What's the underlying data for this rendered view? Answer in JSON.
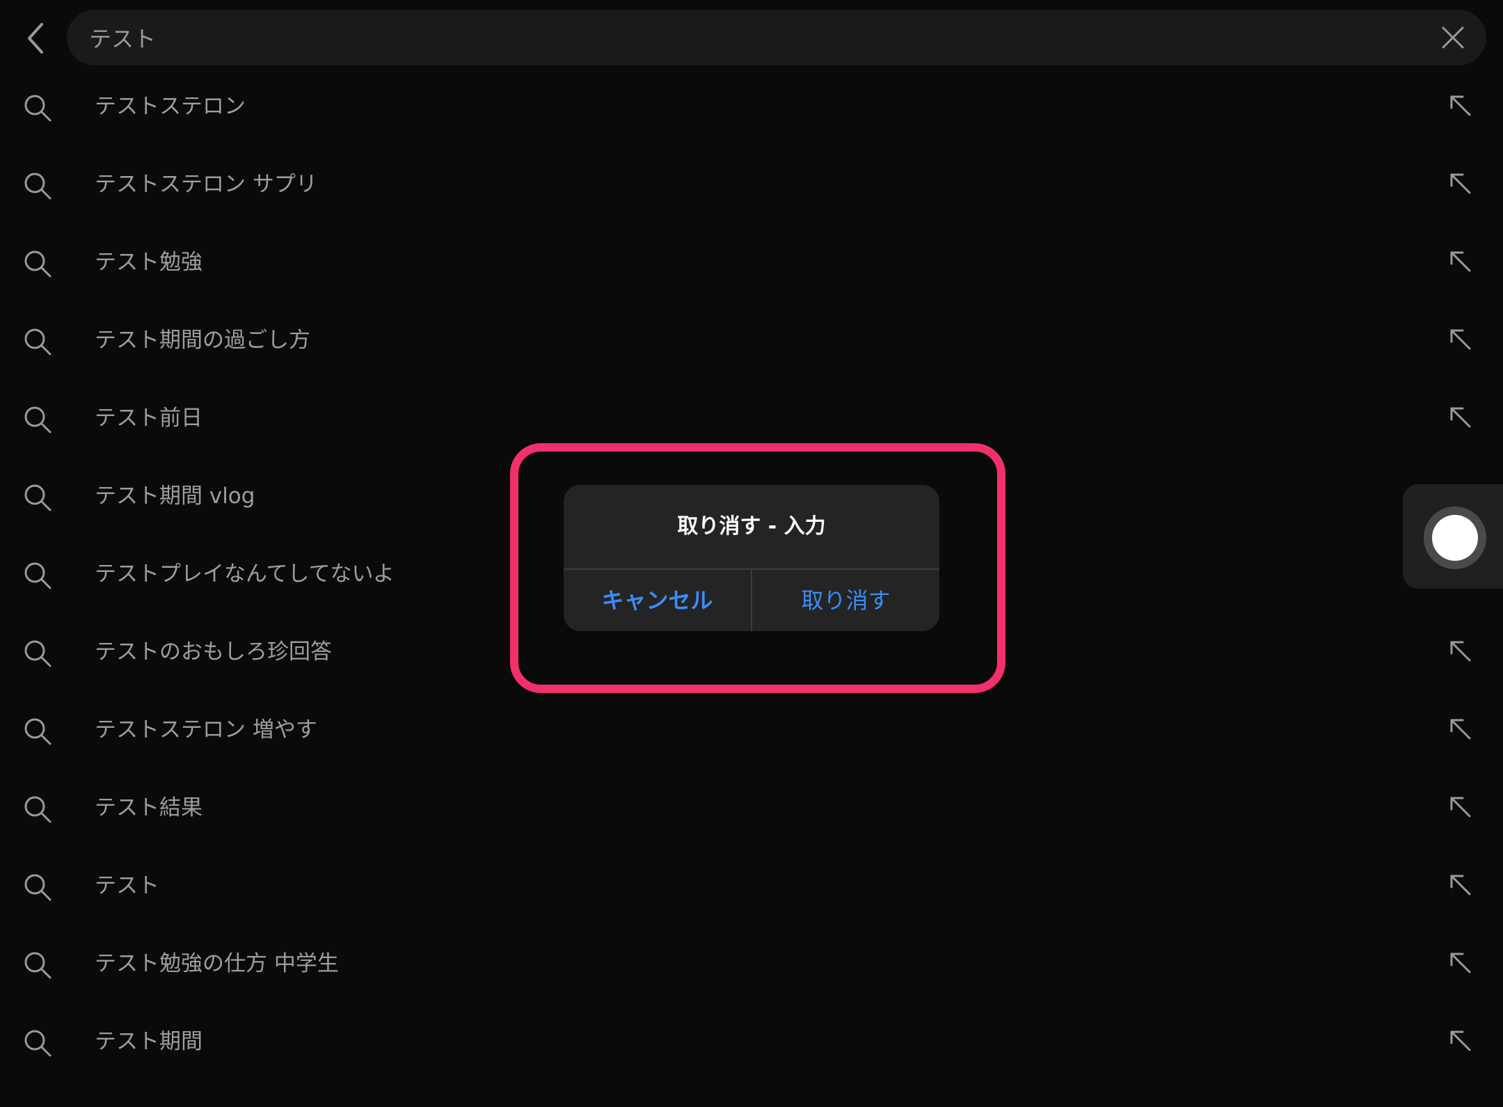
{
  "search": {
    "value": "テスト",
    "back_icon": "chevron-left-icon",
    "clear_icon": "close-icon"
  },
  "suggestions": [
    {
      "text": "テストステロン"
    },
    {
      "text": "テストステロン サプリ"
    },
    {
      "text": "テスト勉強"
    },
    {
      "text": "テスト期間の過ごし方"
    },
    {
      "text": "テスト前日"
    },
    {
      "text": "テスト期間 vlog"
    },
    {
      "text": "テストプレイなんてしてないよ"
    },
    {
      "text": "テストのおもしろ珍回答"
    },
    {
      "text": "テストステロン 増やす"
    },
    {
      "text": "テスト結果"
    },
    {
      "text": "テスト"
    },
    {
      "text": "テスト勉強の仕方 中学生"
    },
    {
      "text": "テスト期間"
    }
  ],
  "dialog": {
    "title": "取り消す - 入力",
    "cancel_label": "キャンセル",
    "confirm_label": "取り消す"
  },
  "colors": {
    "background": "#0a0a0a",
    "accent": "#3b8df5",
    "highlight": "#f2306b"
  }
}
